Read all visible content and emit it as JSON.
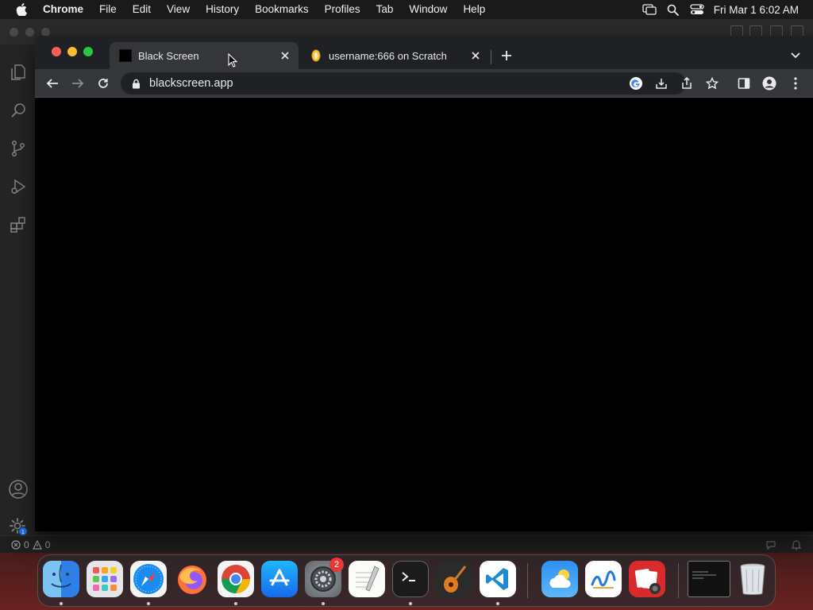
{
  "menubar": {
    "app_name": "Chrome",
    "menus": [
      "File",
      "Edit",
      "View",
      "History",
      "Bookmarks",
      "Profiles",
      "Tab",
      "Window",
      "Help"
    ],
    "clock": "Fri Mar 1  6:02 AM",
    "status_icons": [
      "screen-mirroring-icon",
      "spotlight-search-icon",
      "control-center-icon"
    ]
  },
  "chrome": {
    "tabs": [
      {
        "title": "Black Screen",
        "favicon": "black-square-icon",
        "active": true
      },
      {
        "title": "username:666 on Scratch",
        "favicon": "scratch-cat-icon",
        "active": false
      }
    ],
    "address": {
      "url": "blackscreen.app",
      "secure": true
    },
    "toolbar_icons": [
      "back-icon",
      "forward-icon",
      "reload-icon",
      "google-lens-icon",
      "install-app-icon",
      "share-icon",
      "bookmark-star-icon",
      "side-panel-icon",
      "profile-icon",
      "menu-icon"
    ],
    "page_background": "#000000"
  },
  "vscode": {
    "activity_icons": [
      "explorer-icon",
      "search-icon",
      "source-control-icon",
      "run-debug-icon",
      "extensions-icon",
      "accounts-icon",
      "manage-gear-icon"
    ],
    "manage_badge": "1",
    "status": {
      "errors": "0",
      "warnings": "0"
    }
  },
  "dock": {
    "apps": [
      {
        "name": "Finder",
        "running": true
      },
      {
        "name": "Launchpad",
        "running": false
      },
      {
        "name": "Safari",
        "running": true
      },
      {
        "name": "Firefox",
        "running": false
      },
      {
        "name": "Google Chrome",
        "running": true
      },
      {
        "name": "App Store",
        "running": false
      },
      {
        "name": "System Settings",
        "running": true,
        "badge": "2"
      },
      {
        "name": "TextEdit",
        "running": false
      },
      {
        "name": "Terminal",
        "running": true
      },
      {
        "name": "GarageBand",
        "running": false
      },
      {
        "name": "Visual Studio Code",
        "running": true
      },
      {
        "name": "Weather",
        "running": false
      },
      {
        "name": "Freeform",
        "running": false
      },
      {
        "name": "Photo Booth",
        "running": false
      },
      {
        "name": "Terminal Window",
        "running": false
      },
      {
        "name": "Trash",
        "running": false
      }
    ]
  },
  "colors": {
    "accent_red": "#ff5f57",
    "accent_yellow": "#febc2e",
    "accent_green": "#28c840",
    "tab_active": "#35363a",
    "tab_strip": "#202124"
  }
}
